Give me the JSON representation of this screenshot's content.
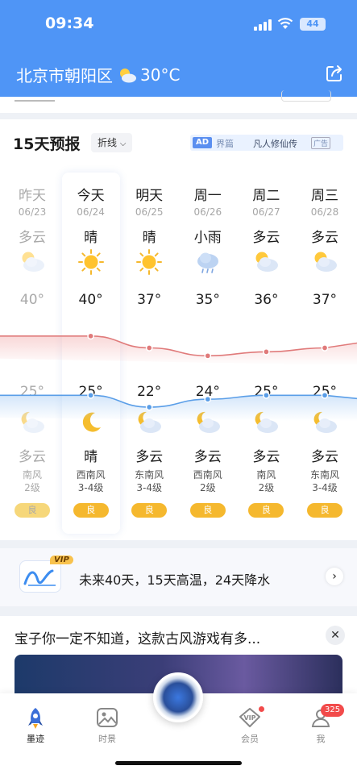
{
  "status": {
    "time": "09:34",
    "battery": "44"
  },
  "header": {
    "location": "北京市朝阳区",
    "temp": "30°C"
  },
  "forecast": {
    "title": "15天预报",
    "toggle": "折线",
    "ad": {
      "tag": "AD",
      "text1": "界篇",
      "text2": "凡人修仙传",
      "label": "广告"
    },
    "days": [
      {
        "name": "昨天",
        "date": "06/23",
        "day_weather": "多云",
        "day_icon": "partly-cloudy-icon",
        "high": "40°",
        "low": "25°",
        "night_icon": "moon-cloud-icon",
        "night_weather": "多云",
        "wind_dir": "南风",
        "wind_level": "2级",
        "aqi": "良",
        "aqi_color": "#f6d77a",
        "past": true
      },
      {
        "name": "今天",
        "date": "06/24",
        "day_weather": "晴",
        "day_icon": "sun-icon",
        "high": "40°",
        "low": "25°",
        "night_icon": "moon-icon",
        "night_weather": "晴",
        "wind_dir": "西南风",
        "wind_level": "3-4级",
        "aqi": "良",
        "aqi_color": "#f5b82e",
        "past": false
      },
      {
        "name": "明天",
        "date": "06/25",
        "day_weather": "晴",
        "day_icon": "sun-icon",
        "high": "37°",
        "low": "22°",
        "night_icon": "moon-cloud-icon",
        "night_weather": "多云",
        "wind_dir": "东南风",
        "wind_level": "3-4级",
        "aqi": "良",
        "aqi_color": "#f5b82e",
        "past": false
      },
      {
        "name": "周一",
        "date": "06/26",
        "day_weather": "小雨",
        "day_icon": "rain-icon",
        "high": "35°",
        "low": "24°",
        "night_icon": "moon-cloud-icon",
        "night_weather": "多云",
        "wind_dir": "西南风",
        "wind_level": "2级",
        "aqi": "良",
        "aqi_color": "#f5b82e",
        "past": false
      },
      {
        "name": "周二",
        "date": "06/27",
        "day_weather": "多云",
        "day_icon": "partly-cloudy-icon",
        "high": "36°",
        "low": "25°",
        "night_icon": "moon-cloud-icon",
        "night_weather": "多云",
        "wind_dir": "南风",
        "wind_level": "2级",
        "aqi": "良",
        "aqi_color": "#f5b82e",
        "past": false
      },
      {
        "name": "周三",
        "date": "06/28",
        "day_weather": "多云",
        "day_icon": "partly-cloudy-icon",
        "high": "37°",
        "low": "25°",
        "night_icon": "moon-cloud-icon",
        "night_weather": "多云",
        "wind_dir": "东南风",
        "wind_level": "3-4级",
        "aqi": "良",
        "aqi_color": "#f5b82e",
        "past": false
      }
    ]
  },
  "chart_data": {
    "type": "line",
    "categories": [
      "昨天",
      "今天",
      "明天",
      "周一",
      "周二",
      "周三"
    ],
    "series": [
      {
        "name": "high",
        "values": [
          40,
          40,
          37,
          35,
          36,
          37
        ],
        "color": "#e07a7a"
      },
      {
        "name": "low",
        "values": [
          25,
          25,
          22,
          24,
          25,
          25
        ],
        "color": "#5a9ee8"
      }
    ]
  },
  "vip": {
    "tag": "VIP",
    "text": "未来40天，15天高温，24天降水"
  },
  "news": {
    "title": "宝子你一定不知道，这款古风游戏有多..."
  },
  "tabs": [
    {
      "label": "墨迹",
      "active": true
    },
    {
      "label": "时景",
      "active": false
    },
    {
      "label": "会员",
      "active": false
    },
    {
      "label": "我",
      "active": false
    }
  ],
  "profile_badge": "325"
}
